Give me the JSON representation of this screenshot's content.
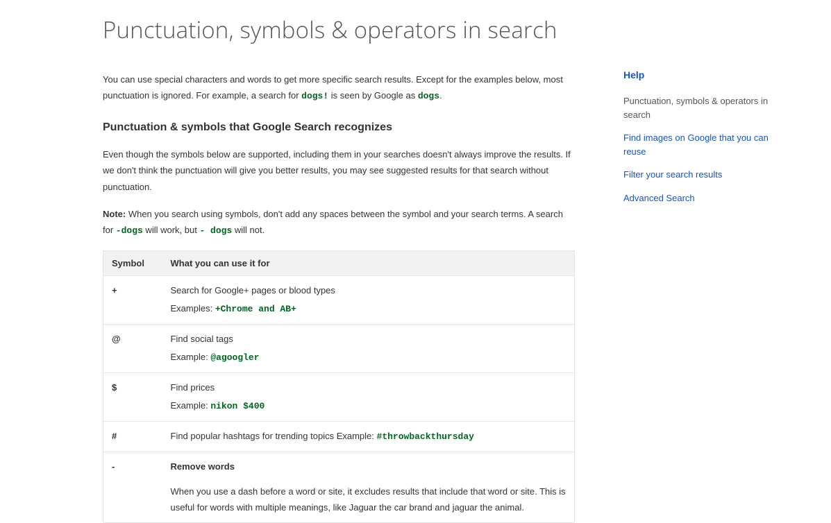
{
  "title": "Punctuation, symbols & operators in search",
  "intro": {
    "p1a": "You can use special characters and words to get more specific search results. Except for the examples below, most punctuation is ignored. For example, a search for ",
    "c1": "dogs!",
    "p1b": " is seen by Google as ",
    "c2": "dogs",
    "p1c": "."
  },
  "section1": {
    "heading": "Punctuation & symbols that Google Search recognizes",
    "p": "Even though the symbols below are supported, including them in your searches doesn't always improve the results. If we don't think the punctuation will give you better results, you may see suggested results for that search without punctuation.",
    "noteLabel": "Note:",
    "noteA": " When you search using symbols, don't add any spaces between the symbol and your search terms. A search for ",
    "noteC1": "-dogs",
    "noteB": " will work, but ",
    "noteC2": "-  dogs",
    "noteC": " will not."
  },
  "table": {
    "h1": "Symbol",
    "h2": "What you can use it for",
    "rows": [
      {
        "sym": "+",
        "desc": "Search for Google+ pages or blood types",
        "exLabel": "Examples: ",
        "exCode": "+Chrome and AB+"
      },
      {
        "sym": "@",
        "desc": "Find social tags",
        "exLabel": "Example: ",
        "exCode": "@agoogler"
      },
      {
        "sym": "$",
        "desc": "Find prices",
        "exLabel": "Example: ",
        "exCode": "nikon $400"
      },
      {
        "sym": "#",
        "desc": "Find popular hashtags for trending topics Example: ",
        "exCode": "#throwbackthursday"
      },
      {
        "sym": "-",
        "strong": "Remove words",
        "desc": "When you use a dash before a word or site, it excludes results that include that word or site. This is useful for words with multiple meanings, like Jaguar the car brand and jaguar the animal."
      }
    ]
  },
  "sidebar": {
    "help": "Help",
    "links": [
      {
        "label": "Punctuation, symbols & operators in search",
        "current": true
      },
      {
        "label": "Find images on Google that you can reuse",
        "current": false
      },
      {
        "label": "Filter your search results",
        "current": false
      },
      {
        "label": "Advanced Search",
        "current": false
      }
    ]
  }
}
